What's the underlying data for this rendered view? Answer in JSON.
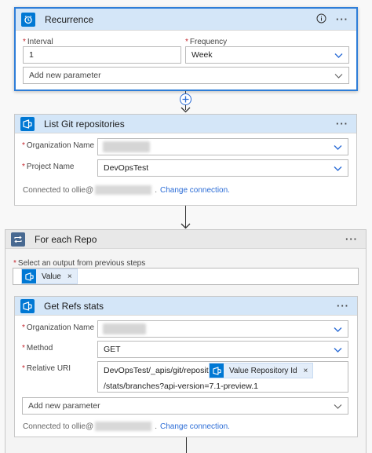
{
  "recurrence": {
    "title": "Recurrence",
    "interval_label": "Interval",
    "interval_value": "1",
    "frequency_label": "Frequency",
    "frequency_value": "Week",
    "add_param_placeholder": "Add new parameter",
    "required_mark": "*",
    "more_label": "···"
  },
  "list_git": {
    "title": "List Git repositories",
    "org_label": "Organization Name",
    "project_label": "Project Name",
    "project_value": "DevOpsTest",
    "connected_prefix": "Connected to ollie@",
    "connected_suffix": ".",
    "change_connection": "Change connection.",
    "more_label": "···"
  },
  "for_each": {
    "title": "For each Repo",
    "select_label": "Select an output from previous steps",
    "token_label": "Value",
    "token_remove": "×",
    "more_label": "···"
  },
  "get_refs": {
    "title": "Get Refs stats",
    "org_label": "Organization Name",
    "method_label": "Method",
    "method_value": "GET",
    "uri_label": "Relative URI",
    "uri_prefix": "DevOpsTest/_apis/git/repositories/",
    "uri_token": "Value Repository Id",
    "uri_token_remove": "×",
    "uri_suffix": "/stats/branches?api-version=7.1-preview.1",
    "add_param_placeholder": "Add new parameter",
    "connected_prefix": "Connected to ollie@",
    "connected_suffix": ".",
    "change_connection": "Change connection.",
    "more_label": "···"
  },
  "colors": {
    "accent": "#0078d4",
    "selected_border": "#2f7ed8",
    "header_blue": "#d4e6f8",
    "foreach_header": "#e8e8e8",
    "required": "#c4262e",
    "link": "#2b6cd6"
  },
  "icons": {
    "recurrence": "alarm-clock-icon",
    "devops": "azure-devops-icon",
    "foreach": "loop-icon",
    "info": "info-icon",
    "chevron": "chevron-down-icon",
    "add": "plus-circle-icon"
  }
}
